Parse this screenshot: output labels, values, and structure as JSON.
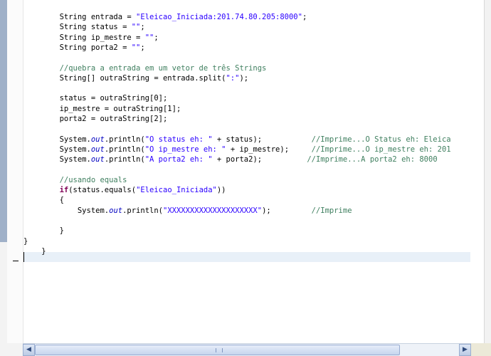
{
  "editor": {
    "lines": [
      {
        "indent": "        ",
        "parts": [
          {
            "t": "String entrada = ",
            "c": ""
          },
          {
            "t": "\"Eleicao_Iniciada:201.74.80.205:8000\"",
            "c": "str"
          },
          {
            "t": ";",
            "c": ""
          }
        ]
      },
      {
        "indent": "        ",
        "parts": [
          {
            "t": "String status = ",
            "c": ""
          },
          {
            "t": "\"\"",
            "c": "str"
          },
          {
            "t": ";",
            "c": ""
          }
        ]
      },
      {
        "indent": "        ",
        "parts": [
          {
            "t": "String ip_mestre = ",
            "c": ""
          },
          {
            "t": "\"\"",
            "c": "str"
          },
          {
            "t": ";",
            "c": ""
          }
        ]
      },
      {
        "indent": "        ",
        "parts": [
          {
            "t": "String porta2 = ",
            "c": ""
          },
          {
            "t": "\"\"",
            "c": "str"
          },
          {
            "t": ";",
            "c": ""
          }
        ]
      },
      {
        "indent": "",
        "parts": []
      },
      {
        "indent": "        ",
        "parts": [
          {
            "t": "//quebra a entrada em um vetor de três Strings",
            "c": "cmt"
          }
        ]
      },
      {
        "indent": "        ",
        "parts": [
          {
            "t": "String[] outraString = entrada.split(",
            "c": ""
          },
          {
            "t": "\":\"",
            "c": "str"
          },
          {
            "t": ");",
            "c": ""
          }
        ]
      },
      {
        "indent": "",
        "parts": []
      },
      {
        "indent": "        ",
        "parts": [
          {
            "t": "status = outraString[0];",
            "c": ""
          }
        ]
      },
      {
        "indent": "        ",
        "parts": [
          {
            "t": "ip_mestre = outraString[1];",
            "c": ""
          }
        ]
      },
      {
        "indent": "        ",
        "parts": [
          {
            "t": "porta2 = outraString[2];",
            "c": ""
          }
        ]
      },
      {
        "indent": "",
        "parts": []
      },
      {
        "indent": "        ",
        "parts": [
          {
            "t": "System.",
            "c": ""
          },
          {
            "t": "out",
            "c": "field"
          },
          {
            "t": ".println(",
            "c": ""
          },
          {
            "t": "\"O status eh: \"",
            "c": "str"
          },
          {
            "t": " + status);           ",
            "c": ""
          },
          {
            "t": "//Imprime...O Status eh: Eleica",
            "c": "cmt"
          }
        ]
      },
      {
        "indent": "        ",
        "parts": [
          {
            "t": "System.",
            "c": ""
          },
          {
            "t": "out",
            "c": "field"
          },
          {
            "t": ".println(",
            "c": ""
          },
          {
            "t": "\"O ip_mestre eh: \"",
            "c": "str"
          },
          {
            "t": " + ip_mestre);     ",
            "c": ""
          },
          {
            "t": "//Imprime...O ip_mestre eh: 201",
            "c": "cmt"
          }
        ]
      },
      {
        "indent": "        ",
        "parts": [
          {
            "t": "System.",
            "c": ""
          },
          {
            "t": "out",
            "c": "field"
          },
          {
            "t": ".println(",
            "c": ""
          },
          {
            "t": "\"A porta2 eh: \"",
            "c": "str"
          },
          {
            "t": " + porta2);          ",
            "c": ""
          },
          {
            "t": "//Imprime...A porta2 eh: 8000",
            "c": "cmt"
          }
        ]
      },
      {
        "indent": "",
        "parts": []
      },
      {
        "indent": "        ",
        "parts": [
          {
            "t": "//usando equals",
            "c": "cmt"
          }
        ]
      },
      {
        "indent": "        ",
        "parts": [
          {
            "t": "if",
            "c": "kw"
          },
          {
            "t": "(status.equals(",
            "c": ""
          },
          {
            "t": "\"Eleicao_Iniciada\"",
            "c": "str"
          },
          {
            "t": "))",
            "c": ""
          }
        ]
      },
      {
        "indent": "        ",
        "parts": [
          {
            "t": "{",
            "c": ""
          }
        ]
      },
      {
        "indent": "            ",
        "parts": [
          {
            "t": "System.",
            "c": ""
          },
          {
            "t": "out",
            "c": "field"
          },
          {
            "t": ".println(",
            "c": ""
          },
          {
            "t": "\"XXXXXXXXXXXXXXXXXXXX\"",
            "c": "str"
          },
          {
            "t": ");         ",
            "c": ""
          },
          {
            "t": "//Imprime",
            "c": "cmt"
          }
        ]
      },
      {
        "indent": "",
        "parts": []
      },
      {
        "indent": "        ",
        "parts": [
          {
            "t": "}",
            "c": ""
          }
        ]
      },
      {
        "indent": "",
        "parts": [
          {
            "t": "}",
            "c": ""
          }
        ]
      },
      {
        "indent": "    ",
        "parts": [
          {
            "t": "}",
            "c": ""
          }
        ]
      },
      {
        "indent": "",
        "parts": []
      }
    ]
  },
  "scrollbar": {
    "left_arrow": "◀",
    "right_arrow": "▶",
    "position_fraction": 0.0,
    "thumb_fraction": 0.86
  }
}
